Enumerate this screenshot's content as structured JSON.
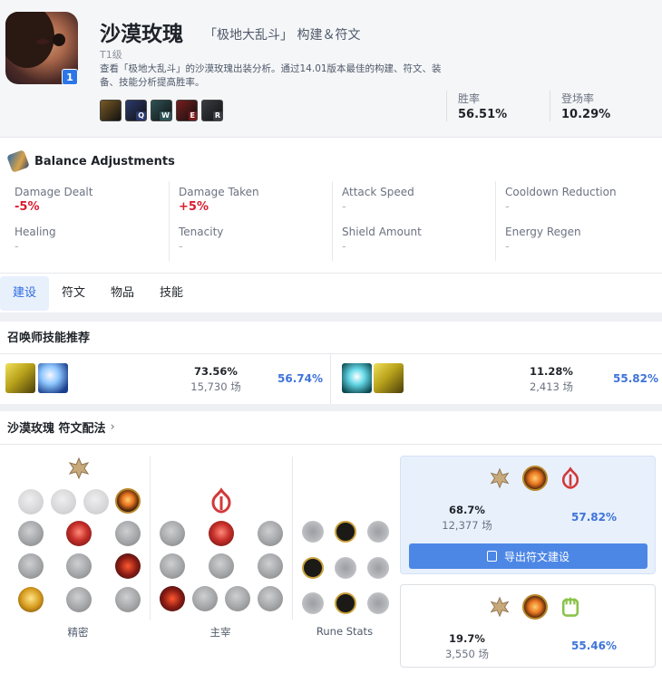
{
  "champion": {
    "name": "沙漠玫瑰",
    "subtitle": "「极地大乱斗」 构建＆符文",
    "tier": "T1级",
    "level": "1",
    "description": "查看「极地大乱斗」的沙漠玫瑰出装分析。通过14.01版本最佳的构建、符文、装备、技能分析提高胜率。"
  },
  "skill_order": [
    {
      "key": "",
      "color": "#7a5a24"
    },
    {
      "key": "Q",
      "color": "#2b3a6e"
    },
    {
      "key": "W",
      "color": "#2e5357"
    },
    {
      "key": "E",
      "color": "#7a1d1d"
    },
    {
      "key": "R",
      "color": "#3a3d44"
    }
  ],
  "stats": {
    "winrate_label": "胜率",
    "winrate_value": "56.51%",
    "pickrate_label": "登场率",
    "pickrate_value": "10.29%"
  },
  "balance": {
    "title": "Balance Adjustments",
    "items": [
      {
        "name": "Damage Dealt",
        "value": "-5%"
      },
      {
        "name": "Damage Taken",
        "value": "+5%"
      },
      {
        "name": "Attack Speed",
        "value": "-"
      },
      {
        "name": "Cooldown Reduction",
        "value": "-"
      },
      {
        "name": "Healing",
        "value": "-"
      },
      {
        "name": "Tenacity",
        "value": "-"
      },
      {
        "name": "Shield Amount",
        "value": "-"
      },
      {
        "name": "Energy Regen",
        "value": "-"
      }
    ]
  },
  "tabs": [
    "建设",
    "符文",
    "物品",
    "技能"
  ],
  "summoner": {
    "title": "召唤师技能推荐",
    "combos": [
      {
        "pick": "73.56%",
        "games": "15,730 场",
        "win": "56.74%"
      },
      {
        "pick": "11.28%",
        "games": "2,413 场",
        "win": "55.82%"
      }
    ]
  },
  "runes": {
    "title": "沙漠玫瑰 符文配法",
    "trees": [
      "精密",
      "主宰",
      "Rune Stats"
    ],
    "builds": [
      {
        "pick": "68.7%",
        "games": "12,377 场",
        "win": "57.82%",
        "export_label": "导出符文建设"
      },
      {
        "pick": "19.7%",
        "games": "3,550 场",
        "win": "55.46%"
      }
    ]
  },
  "colors": {
    "accent": "#2d6ce0",
    "win": "#3f73d9",
    "negative": "#d91c2e"
  }
}
